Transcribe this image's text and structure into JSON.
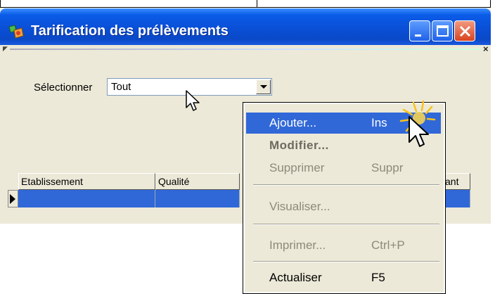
{
  "window": {
    "title": "Tarification des prélèvements",
    "buttons": [
      "minimize",
      "maximize",
      "close"
    ]
  },
  "filter": {
    "label": "Sélectionner",
    "value": "Tout"
  },
  "grid": {
    "columns": [
      "Etablissement",
      "Qualité",
      "ant"
    ]
  },
  "context_menu": {
    "items": [
      {
        "label": "Ajouter...",
        "shortcut": "Ins",
        "state": "highlighted"
      },
      {
        "label": "Modifier...",
        "shortcut": "",
        "state": "bold"
      },
      {
        "label": "Supprimer",
        "shortcut": "Suppr",
        "state": "disabled"
      },
      {
        "label": "Visualiser...",
        "shortcut": "",
        "state": "disabled"
      },
      {
        "label": "Imprimer...",
        "shortcut": "Ctrl+P",
        "state": "disabled"
      },
      {
        "label": "Actualiser",
        "shortcut": "F5",
        "state": "normal"
      }
    ]
  },
  "colors": {
    "titlebar": "#0a4fd6",
    "selection": "#3168d8",
    "window_bg": "#ece9d8",
    "close_button": "#d9431e"
  }
}
